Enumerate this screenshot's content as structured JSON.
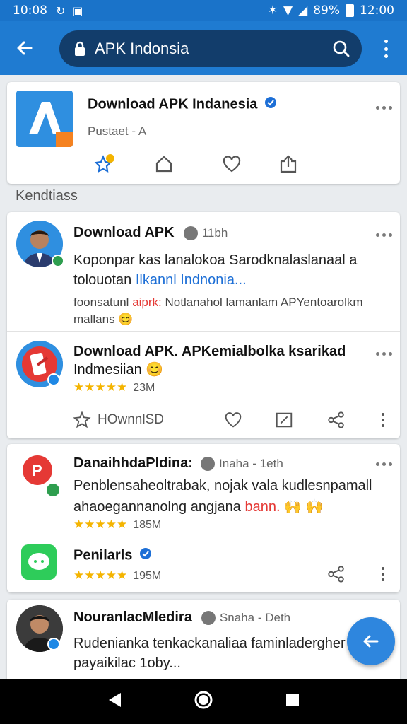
{
  "status_bar": {
    "time": "10:08",
    "battery": "89%",
    "clock_right": "12:00"
  },
  "search": {
    "text": "APK Indonsia"
  },
  "top_card": {
    "title": "Download APK Indanesia",
    "subtitle": "Pustaet - A"
  },
  "section": {
    "label": "Kendtiass"
  },
  "post1": {
    "author": "Download APK",
    "time": "11bh",
    "text_line1": "Koponpar kas lanalokoa Sarodknalaslanaal a",
    "text_line2_plain": "tolouotan ",
    "text_line2_link": "Ilkannl Indnonia...",
    "note_a": "foonsatunl ",
    "note_red": "aiprk:",
    "note_b": " Notlanahol lamanlam APYentoarolkm",
    "note_line2": "mallans 😊"
  },
  "post2": {
    "title_line1": "Download APK. APKemialbolka ksarikad",
    "title_line2": "Indmesiian 😊",
    "stars": "★★★★★",
    "rating_count": "23M",
    "action_label": "HOwnnlSD"
  },
  "post3": {
    "author": "DanaihhdaPldina:",
    "time": "Inaha - 1eth",
    "text_line1": "Penblensaheoltrabak, nojak vala kudlesnpamall",
    "text_line2_a": "ahaoegannanolng angjana ",
    "text_line2_red": "bann.",
    "text_line2_emoji": " 🙌 🙌",
    "stars": "★★★★★",
    "rating_count": "185M",
    "sub_title": "Penilarls",
    "sub_stars": "★★★★★",
    "sub_count": "195M"
  },
  "post4": {
    "author": "NouranlacMledira",
    "time": "Snaha - Deth",
    "text_line1": "Rudenianka tenkackanaliaa faminladergher",
    "text_line2": "payaikilac 1oby..."
  },
  "colors": {
    "primary": "#1f7bd1",
    "search_bg": "#123d6b",
    "fab": "#2e86de",
    "star": "#f4b400"
  }
}
